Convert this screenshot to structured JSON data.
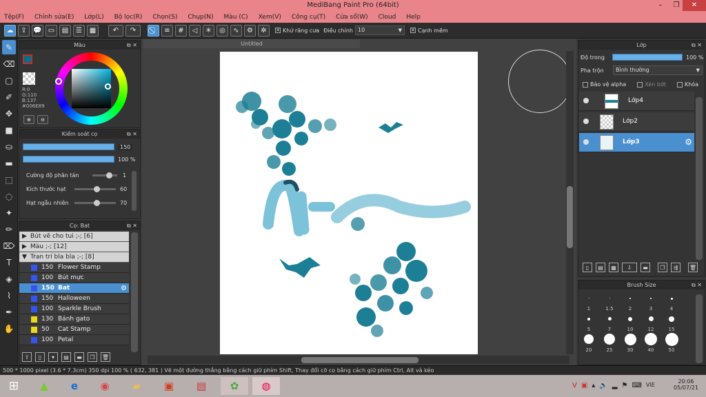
{
  "window": {
    "title": "MediBang Paint Pro (64bit)",
    "minimize": "–",
    "maximize": "❐",
    "close": "✕"
  },
  "menu": [
    "Tệp(F)",
    "Chỉnh sửa(E)",
    "Lớp(L)",
    "Bộ lọc(R)",
    "Chọn(S)",
    "Chụp(N)",
    "Màu (C)",
    "Xem(V)",
    "Công cụ(T)",
    "Cửa sổ(W)",
    "Cloud",
    "Help"
  ],
  "toolbar": {
    "antialias_label": "Khử răng cưa",
    "correction_label": "Điều chỉnh",
    "correction_value": "10",
    "soft_edge_label": "Cạnh mềm"
  },
  "color_panel": {
    "title": "Màu",
    "r": "R:0",
    "g": "G:110",
    "b": "B:137",
    "hex": "#006E89",
    "accent": "#006E89"
  },
  "brush_control": {
    "title": "Kiểm soát cọ",
    "size_value": "150",
    "opacity_value": "100 %",
    "rows": [
      {
        "label": "Cường độ phân tán",
        "value": "1"
      },
      {
        "label": "Kích thước hạt",
        "value": "60"
      },
      {
        "label": "Hạt ngẫu nhiên",
        "value": "70"
      }
    ]
  },
  "brush_panel": {
    "title": "Cọ: Bat",
    "groups": [
      {
        "arrow": "▶",
        "label": "Bút vẽ cho tui ;-; [6]"
      },
      {
        "arrow": "▶",
        "label": "Màu ;-; [12]"
      },
      {
        "arrow": "▼",
        "label": "Tran trí bla bla ;-; [8]"
      }
    ],
    "items": [
      {
        "size": "150",
        "name": "Flower Stamp",
        "color": "#3355ee"
      },
      {
        "size": "100",
        "name": "Bút mực",
        "color": "#3355ee"
      },
      {
        "size": "150",
        "name": "Bat",
        "color": "#3355ee"
      },
      {
        "size": "150",
        "name": "Halloween",
        "color": "#3355ee"
      },
      {
        "size": "100",
        "name": "Sparkle Brush",
        "color": "#3355ee"
      },
      {
        "size": "130",
        "name": "Bánh gato",
        "color": "#e8d820"
      },
      {
        "size": "50",
        "name": "Cat Stamp",
        "color": "#e8d820"
      },
      {
        "size": "100",
        "name": "Petal",
        "color": "#3355ee"
      }
    ]
  },
  "document": {
    "tab": "Untitled"
  },
  "layer_panel": {
    "title": "Lớp",
    "opacity_label": "Độ trong",
    "opacity_value": "100 %",
    "blend_label": "Pha trộn",
    "blend_value": "Bình thường",
    "protect_alpha": "Bảo vệ alpha",
    "clipping": "Xén bớt",
    "lock": "Khóa",
    "layers": [
      "Lớp4",
      "Lớp2",
      "Lớp3"
    ]
  },
  "brush_size_panel": {
    "title": "Brush Size",
    "sizes": [
      "1",
      "1.5",
      "2",
      "3",
      "4",
      "5",
      "7",
      "10",
      "12",
      "15",
      "20",
      "25",
      "30",
      "40",
      "50"
    ]
  },
  "status": {
    "text": "500 * 1000 pixel   (3.6 * 7.3cm)   350 dpi   100 %   ( 632, 381 )   Vẽ một đường thẳng bằng cách giữ phím Shift, Thay đổi cỡ cọ bằng cách giữ phím Ctrl, Alt và kéo"
  },
  "taskbar": {
    "lang": "VIE",
    "time": "20:06",
    "date": "05/07/21"
  }
}
